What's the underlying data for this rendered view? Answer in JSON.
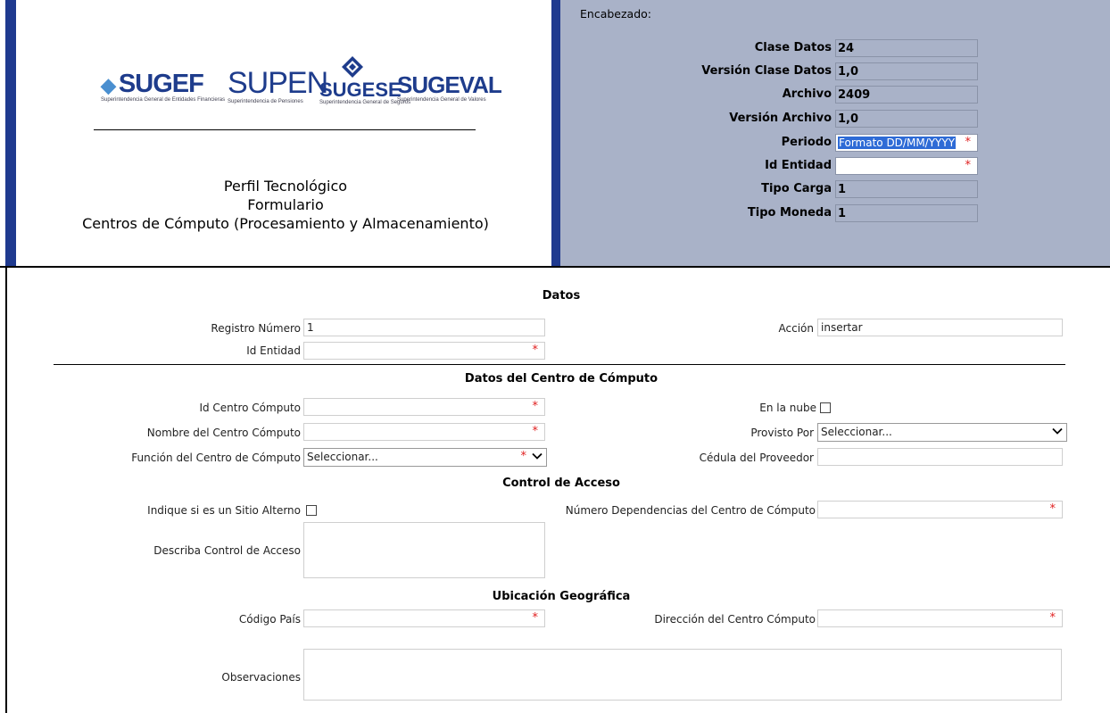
{
  "header": {
    "caption": "Encabezado:",
    "logos": {
      "sugef": "SUGEF",
      "sugef_sub": "Superintendencia General de Entidades Financieras",
      "supen": "SUPEN",
      "supen_sub": "Superintendencia de Pensiones",
      "sugese": "SUGESE",
      "sugese_sub": "Superintendencia General de Seguros",
      "sugeval": "SUGEVAL",
      "sugeval_sub": "Superintendencia General de Valores"
    },
    "title_lines": [
      "Perfil Tecnológico",
      "Formulario",
      "Centros de Cómputo (Procesamiento y Almacenamiento)"
    ],
    "fields": [
      {
        "label": "Clase Datos",
        "value": "24"
      },
      {
        "label": "Versión Clase Datos",
        "value": "1,0"
      },
      {
        "label": "Archivo",
        "value": "2409"
      },
      {
        "label": "Versión Archivo",
        "value": "1,0"
      },
      {
        "label": "Periodo",
        "value": "Formato DD/MM/YYYY",
        "required": "*"
      },
      {
        "label": "Id Entidad",
        "value": "",
        "required": "*"
      },
      {
        "label": "Tipo Carga",
        "value": "1"
      },
      {
        "label": "Tipo Moneda",
        "value": "1"
      }
    ]
  },
  "sections": {
    "datos": "Datos",
    "centro": "Datos del Centro de Cómputo",
    "acceso": "Control de Acceso",
    "ubicacion": "Ubicación Geográfica"
  },
  "form": {
    "registro_label": "Registro Número",
    "registro_value": "1",
    "accion_label": "Acción",
    "accion_value": "insertar",
    "id_entidad_label": "Id Entidad",
    "id_centro_label": "Id Centro Cómputo",
    "nube_label": "En la nube",
    "nombre_label": "Nombre del Centro Cómputo",
    "provisto_label": "Provisto Por",
    "provisto_value": "Seleccionar...",
    "funcion_label": "Función del Centro de Cómputo",
    "funcion_value": "Seleccionar...",
    "cedula_label": "Cédula del Proveedor",
    "sitio_alterno_label": "Indique si es un Sitio Alterno",
    "dependencias_label": "Número Dependencias del Centro de Cómputo",
    "control_label": "Describa Control de Acceso",
    "pais_label": "Código País",
    "direccion_label": "Dirección del Centro Cómputo",
    "observaciones_label": "Observaciones",
    "required_mark": "*"
  },
  "colors": {
    "header_panel": "#a9b2c8",
    "accent_bar": "#1f3a8f",
    "required": "#e02020",
    "selection": "#2e6bd6"
  },
  "icons": {
    "dropdown": "chevron-down-icon",
    "sugese_mark": "sugese-logo-mark"
  }
}
